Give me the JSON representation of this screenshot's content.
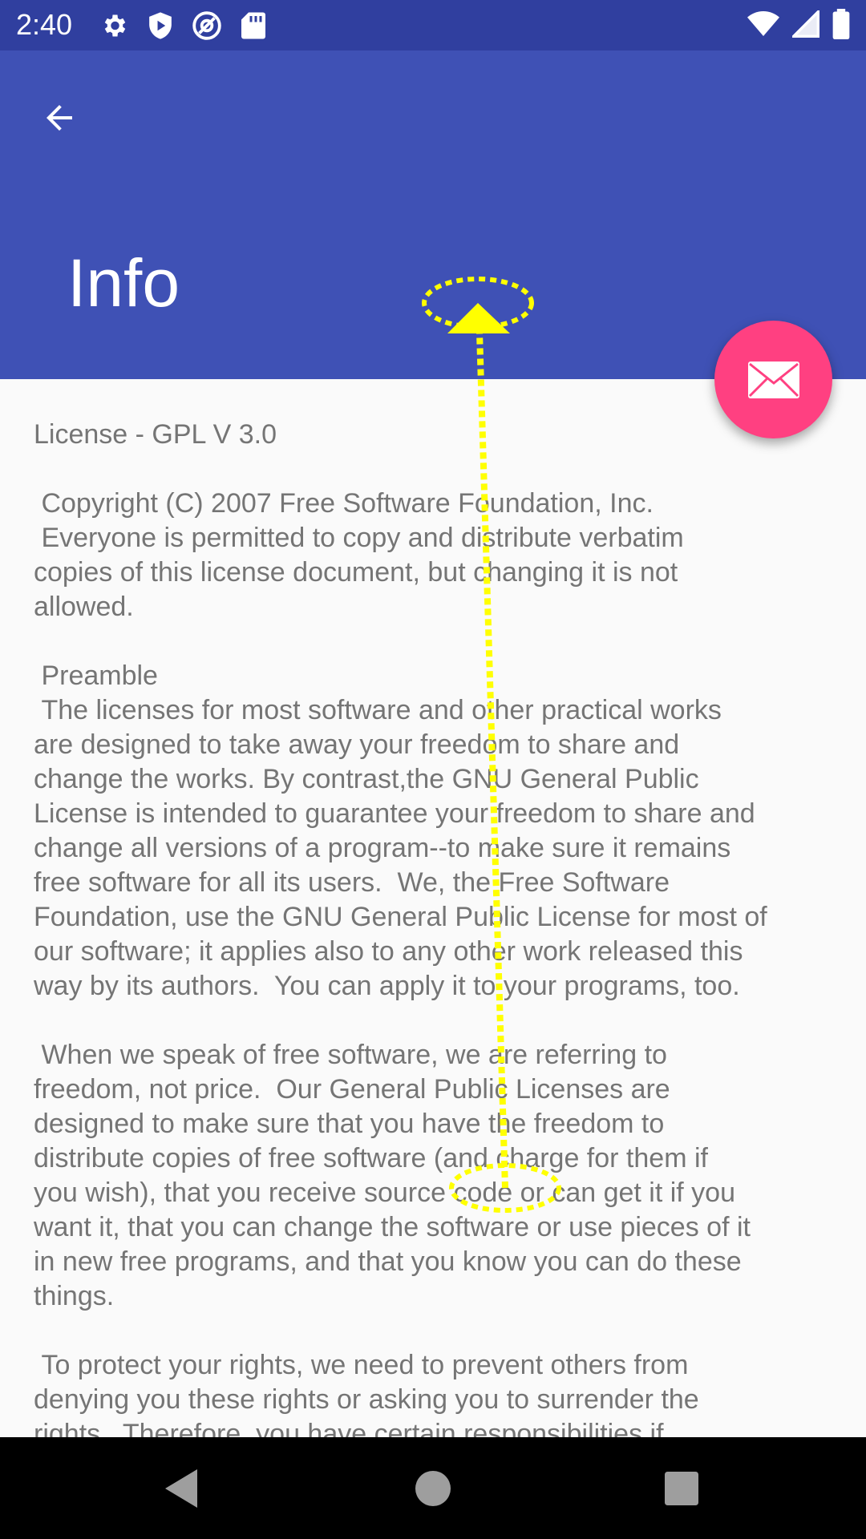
{
  "status_bar": {
    "time": "2:40",
    "left_icons": [
      "gear-icon",
      "play-protect-icon",
      "at-sign-icon",
      "sd-card-icon"
    ],
    "right_icons": [
      "wifi-icon",
      "cell-signal-icon",
      "battery-icon"
    ]
  },
  "app_bar": {
    "title": "Info",
    "background_color": "#3f51b5",
    "back_icon": "arrow-back-icon"
  },
  "fab": {
    "icon": "mail-icon",
    "color": "#ff4081"
  },
  "license": {
    "text": "License - GPL V 3.0\n\n Copyright (C) 2007 Free Software Foundation, Inc.\n Everyone is permitted to copy and distribute verbatim\ncopies of this license document, but changing it is not\nallowed.\n\n Preamble\n The licenses for most software and other practical works\nare designed to take away your freedom to share and\nchange the works. By contrast,the GNU General Public\nLicense is intended to guarantee your freedom to share and\nchange all versions of a program--to make sure it remains\nfree software for all its users.  We, the Free Software\nFoundation, use the GNU General Public License for most of\nour software; it applies also to any other work released this\nway by its authors.  You can apply it to your programs, too.\n\n When we speak of free software, we are referring to\nfreedom, not price.  Our General Public Licenses are\ndesigned to make sure that you have the freedom to\ndistribute copies of free software (and charge for them if\nyou wish), that you receive source code or can get it if you\nwant it, that you can change the software or use pieces of it\nin new free programs, and that you know you can do these\nthings.\n\n To protect your rights, we need to prevent others from\ndenying you these rights or asking you to surrender the\nrights.  Therefore, you have certain responsibilities if"
  },
  "gesture": {
    "type": "swipe-up",
    "color": "#ffff00"
  },
  "nav_bar": {
    "buttons": [
      "back-triangle-icon",
      "home-circle-icon",
      "recents-square-icon"
    ]
  }
}
